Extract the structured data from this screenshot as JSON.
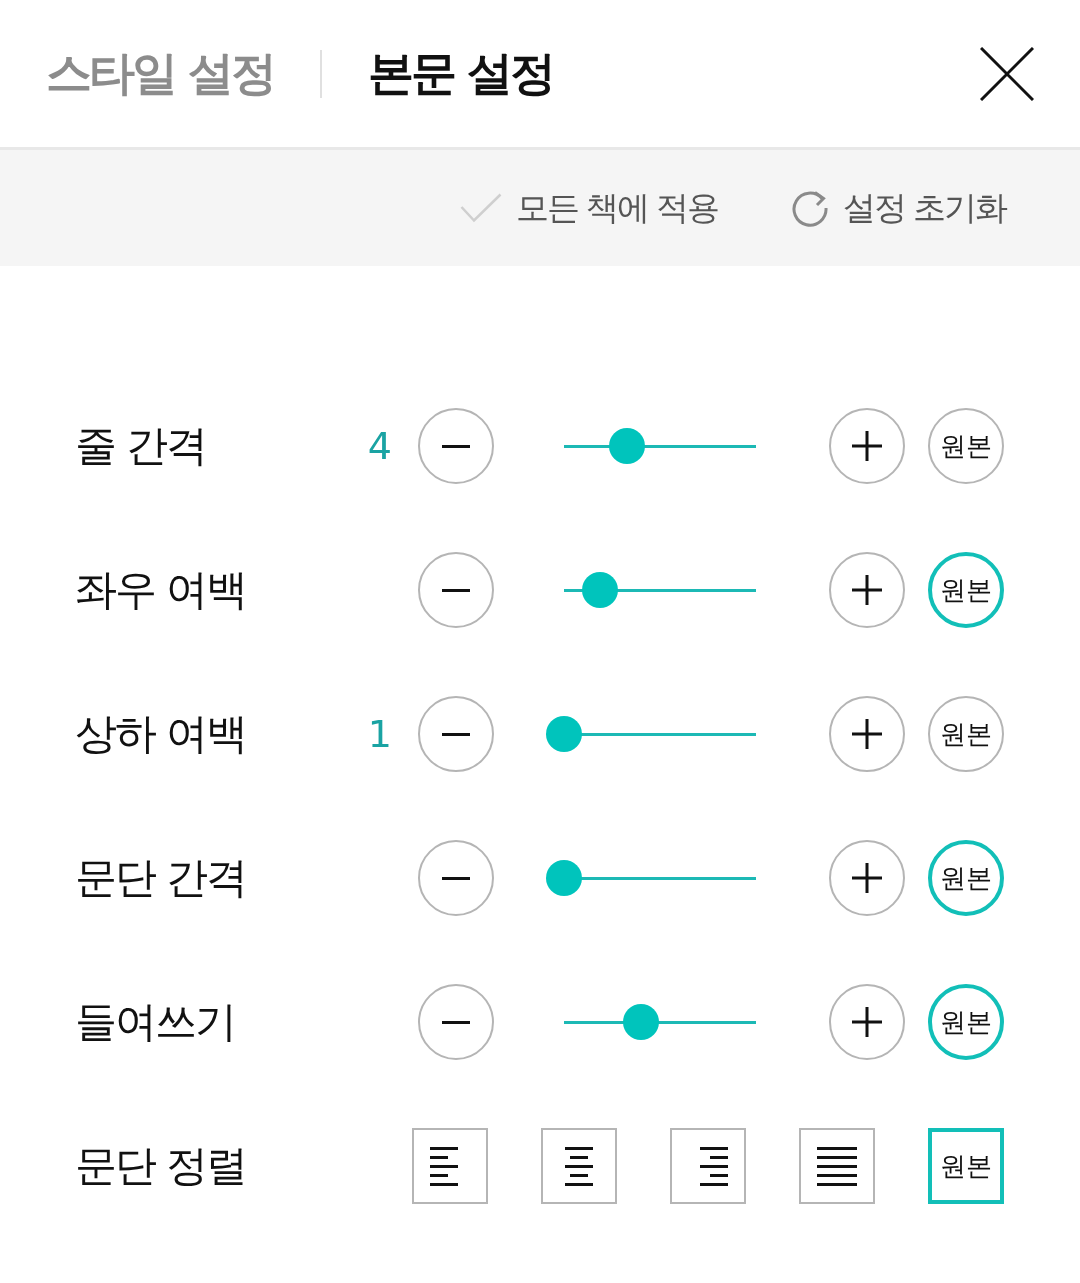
{
  "header": {
    "tabs": [
      {
        "label": "스타일 설정",
        "selected": false
      },
      {
        "label": "본문 설정",
        "selected": true
      }
    ]
  },
  "toolbar": {
    "apply_all": {
      "label": "모든 책에 적용",
      "checked": false
    },
    "reset": {
      "label": "설정 초기화"
    }
  },
  "rows": [
    {
      "kind": "slider",
      "label": "줄 간격",
      "value": "4",
      "level": 0.33,
      "original": {
        "label": "원본",
        "selected": false
      }
    },
    {
      "kind": "slider",
      "label": "좌우 여백",
      "level": 0.19,
      "original": {
        "label": "원본",
        "selected": true
      }
    },
    {
      "kind": "slider",
      "label": "상하 여백",
      "value": "1",
      "level": 0,
      "original": {
        "label": "원본",
        "selected": false
      }
    },
    {
      "kind": "slider",
      "label": "문단 간격",
      "level": 0,
      "original": {
        "label": "원본",
        "selected": true
      }
    },
    {
      "kind": "slider",
      "label": "들여쓰기",
      "level": 0.4,
      "original": {
        "label": "원본",
        "selected": true
      }
    },
    {
      "kind": "alignment",
      "label": "문단 정렬",
      "options": [
        {
          "kind": "left",
          "selected": false
        },
        {
          "kind": "center",
          "selected": false
        },
        {
          "kind": "right",
          "selected": false
        },
        {
          "kind": "justify",
          "selected": false
        },
        {
          "kind": "original",
          "label": "원본",
          "selected": true
        }
      ]
    }
  ]
}
